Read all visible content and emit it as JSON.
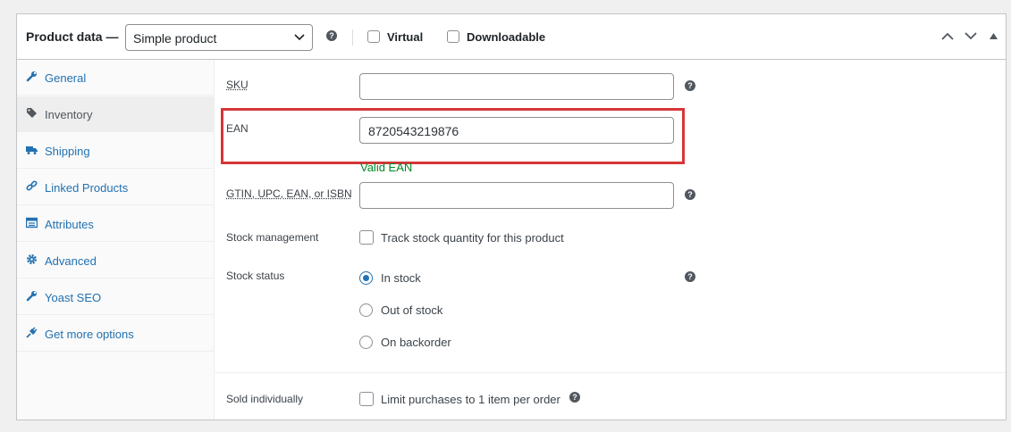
{
  "header": {
    "title": "Product data —",
    "product_type": "Simple product",
    "help_glyph": "?",
    "virtual_label": "Virtual",
    "downloadable_label": "Downloadable"
  },
  "sidebar": {
    "items": [
      {
        "label": "General",
        "icon": "wrench-icon"
      },
      {
        "label": "Inventory",
        "icon": "tag-icon"
      },
      {
        "label": "Shipping",
        "icon": "truck-icon"
      },
      {
        "label": "Linked Products",
        "icon": "link-icon"
      },
      {
        "label": "Attributes",
        "icon": "table-icon"
      },
      {
        "label": "Advanced",
        "icon": "gear-icon"
      },
      {
        "label": "Yoast SEO",
        "icon": "wrench-icon"
      },
      {
        "label": "Get more options",
        "icon": "plugin-icon"
      }
    ]
  },
  "inventory": {
    "sku_label": "SKU",
    "sku_value": "",
    "ean_label": "EAN",
    "ean_value": "8720543219876",
    "ean_status": "Valid EAN",
    "gtin_label": "GTIN, UPC, EAN, or ISBN",
    "gtin_value": "",
    "stock_mgmt_label": "Stock management",
    "stock_mgmt_text": "Track stock quantity for this product",
    "stock_status_label": "Stock status",
    "stock_options": [
      "In stock",
      "Out of stock",
      "On backorder"
    ],
    "selected_stock_option": "In stock",
    "sold_individually_label": "Sold individually",
    "sold_individually_text": "Limit purchases to 1 item per order"
  },
  "colors": {
    "link": "#2271b1",
    "valid": "#008a20",
    "highlight": "#d63638"
  }
}
